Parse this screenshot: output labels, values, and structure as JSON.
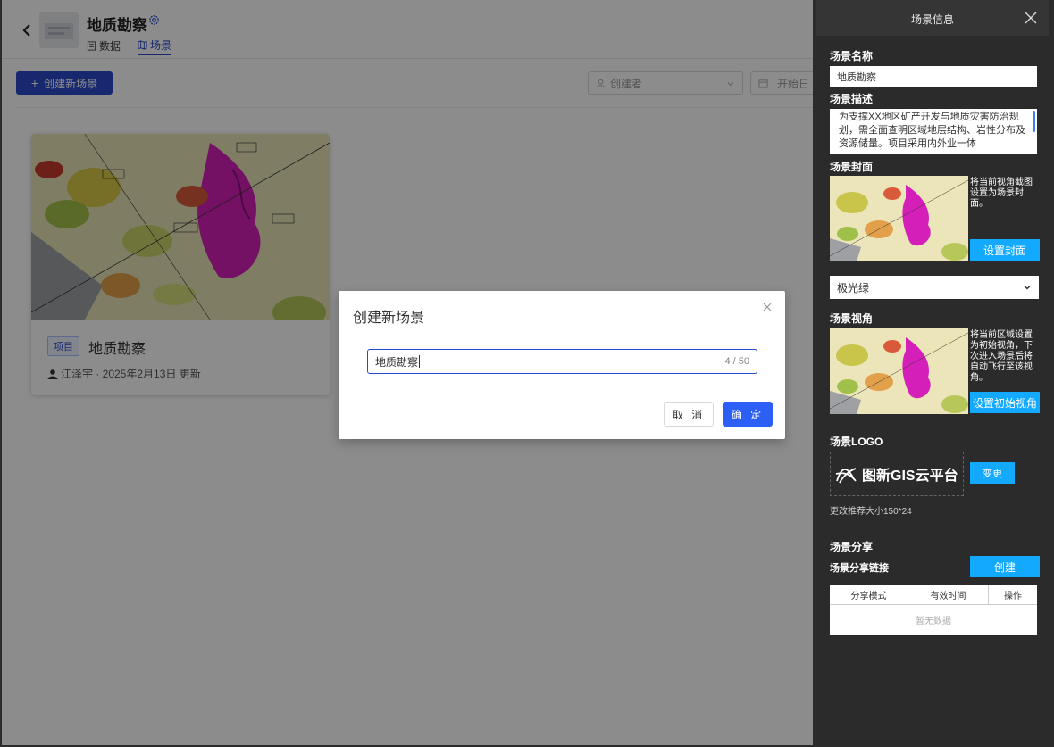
{
  "header": {
    "project_title": "地质勘察",
    "tabs": [
      {
        "label": "数据"
      },
      {
        "label": "场景"
      }
    ],
    "active_tab": "场景"
  },
  "toolbar": {
    "create_label": "创建新场景",
    "creator_placeholder": "创建者",
    "date_placeholder": "开始日"
  },
  "scene_card": {
    "tag": "项目",
    "title": "地质勘察",
    "meta": "江泽宇 · 2025年2月13日 更新"
  },
  "modal": {
    "title": "创建新场景",
    "input_value": "地质勘察",
    "char_count": "4 / 50",
    "cancel_label": "取 消",
    "ok_label": "确 定"
  },
  "panel": {
    "title": "场景信息",
    "name_label": "场景名称",
    "name_value": "地质勘察",
    "desc_label": "场景描述",
    "desc_value": "为支撑XX地区矿产开发与地质灾害防治规划，需全面查明区域地层结构、岩性分布及资源储量。项目采用内外业一体",
    "cover_label": "场景封面",
    "cover_note": "将当前视角截图设置为场景封面。",
    "cover_button": "设置封面",
    "theme_select": "极光绿",
    "view_label": "场景视角",
    "view_note": "将当前区域设置为初始视角，下次进入场景后将自动飞行至该视角。",
    "view_button": "设置初始视角",
    "logo_label": "场景LOGO",
    "logo_text": "图新GIS云平台",
    "logo_change": "变更",
    "logo_hint": "更改推荐大小150*24",
    "share_label": "场景分享",
    "share_link_label": "场景分享链接",
    "share_create": "创建",
    "share_table_headers": [
      "分享模式",
      "有效时间",
      "操作"
    ],
    "share_empty": "暂无数据"
  },
  "colors": {
    "primary": "#2b4acb",
    "confirm": "#2b5ff5",
    "panel_accent": "#12a9ff",
    "panel_bg": "#2b2b2b"
  }
}
